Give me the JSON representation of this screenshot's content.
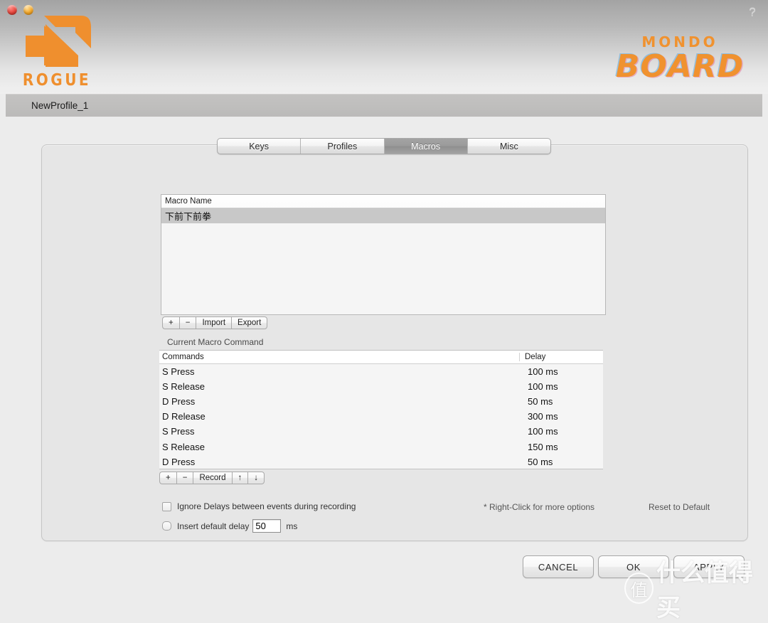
{
  "window": {
    "controls": [
      "close",
      "minimize"
    ],
    "help_label": "?"
  },
  "branding": {
    "rogue_word": "ROGUE",
    "mondo_top": "MONDO",
    "mondo_bottom": "BOARD",
    "accent_color": "#f0922f"
  },
  "profile": {
    "name": "NewProfile_1"
  },
  "tabs": [
    {
      "label": "Keys",
      "active": false
    },
    {
      "label": "Profiles",
      "active": false
    },
    {
      "label": "Macros",
      "active": true
    },
    {
      "label": "Misc",
      "active": false
    }
  ],
  "macro_list": {
    "header": "Macro Name",
    "rows": [
      {
        "name": "下前下前拳",
        "selected": true
      }
    ],
    "buttons": [
      "+",
      "−",
      "Import",
      "Export"
    ]
  },
  "current_macro": {
    "section_label": "Current Macro Command",
    "columns": {
      "commands": "Commands",
      "delay": "Delay"
    },
    "rows": [
      {
        "command": "S Press",
        "delay": "100 ms"
      },
      {
        "command": "S Release",
        "delay": "100 ms"
      },
      {
        "command": "D Press",
        "delay": "50 ms"
      },
      {
        "command": "D Release",
        "delay": "300 ms"
      },
      {
        "command": "S Press",
        "delay": "100 ms"
      },
      {
        "command": "S Release",
        "delay": "150 ms"
      },
      {
        "command": "D Press",
        "delay": "50 ms"
      }
    ],
    "buttons": [
      "+",
      "−",
      "Record",
      "↑",
      "↓"
    ]
  },
  "options": {
    "ignore_delays_label": "Ignore Delays between events during recording",
    "ignore_delays_checked": false,
    "insert_delay_label": "Insert default delay",
    "insert_delay_value": "50",
    "insert_delay_unit": "ms",
    "insert_delay_checked": false,
    "right_click_hint": "* Right-Click for more options",
    "reset_to_default": "Reset to Default"
  },
  "footer": {
    "cancel": "CANCEL",
    "ok": "OK",
    "apply": "APPLY"
  },
  "watermark": {
    "mark": "值",
    "text": "什么值得买"
  }
}
